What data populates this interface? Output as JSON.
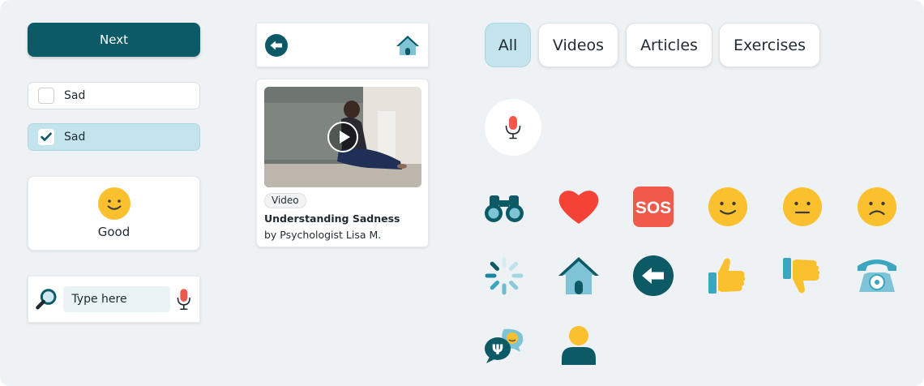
{
  "next_button": {
    "label": "Next"
  },
  "options": [
    {
      "label": "Sad",
      "checked": false
    },
    {
      "label": "Sad",
      "checked": true
    }
  ],
  "mood_card": {
    "label": "Good",
    "icon": "smiley-happy-icon"
  },
  "search": {
    "placeholder": "Type here",
    "icon": "magnifier-icon",
    "mic_icon": "microphone-icon"
  },
  "top_bar": {
    "back_icon": "back-arrow-icon",
    "home_icon": "home-icon"
  },
  "video_card": {
    "tag": "Video",
    "title": "Understanding Sadness",
    "author": "by Psychologist Lisa M."
  },
  "filter_tabs": [
    {
      "label": "All",
      "active": true
    },
    {
      "label": "Videos",
      "active": false
    },
    {
      "label": "Articles",
      "active": false
    },
    {
      "label": "Exercises",
      "active": false
    }
  ],
  "sos_label": "SOS",
  "icon_grid": [
    [
      "binoculars-icon",
      "heart-icon",
      "sos-icon",
      "smiley-happy-icon",
      "smiley-neutral-icon",
      "smiley-sad-icon"
    ],
    [
      "loading-spinner-icon",
      "home-icon",
      "back-arrow-icon",
      "thumbs-up-icon",
      "thumbs-down-icon",
      "telephone-icon"
    ],
    [
      "psychology-chat-icon",
      "user-icon"
    ]
  ],
  "colors": {
    "primary": "#0b5a66",
    "accent_light": "#c3e4ec",
    "emoji_yellow": "#fbc02d",
    "heart_red": "#f44336",
    "sos_red": "#f15a4b",
    "teal_icon": "#3aa6bf"
  }
}
